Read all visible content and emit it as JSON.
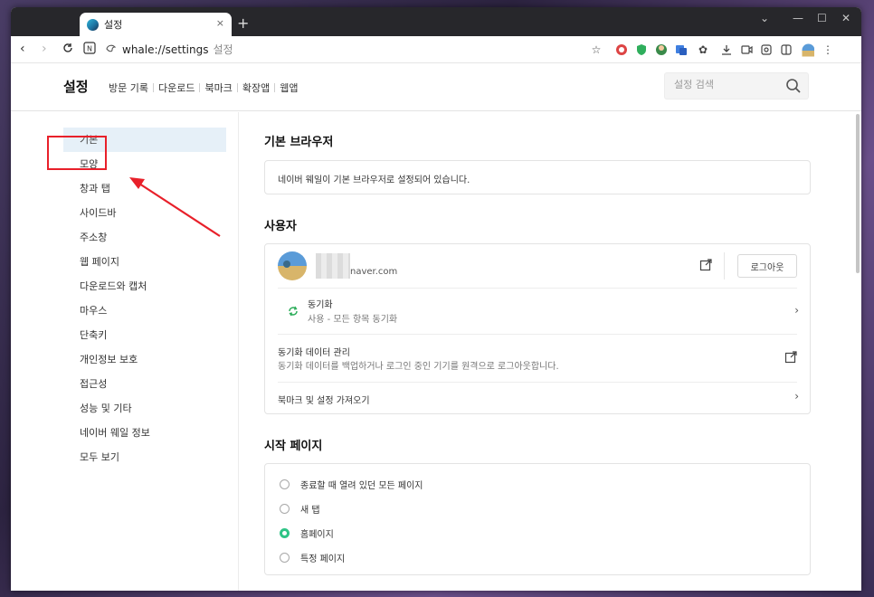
{
  "browser": {
    "tab_title": "설정",
    "new_tab_symbol": "+",
    "tab_close_symbol": "×",
    "window_controls": {
      "menu": "⌄",
      "minimize": "—",
      "maximize": "☐",
      "close": "✕"
    },
    "url": "whale://settings",
    "url_suffix": "설정"
  },
  "settings_header": {
    "title": "설정",
    "links": [
      "방문 기록",
      "다운로드",
      "북마크",
      "확장앱",
      "웹앱"
    ],
    "search_placeholder": "설정 검색"
  },
  "sidebar": {
    "items": [
      "기본",
      "모양",
      "창과 탭",
      "사이드바",
      "주소창",
      "웹 페이지",
      "다운로드와 캡처",
      "마우스",
      "단축키",
      "개인정보 보호",
      "접근성",
      "성능 및 기타",
      "네이버 웨일 정보",
      "모두 보기"
    ],
    "active_index": 0
  },
  "default_browser": {
    "title": "기본 브라우저",
    "status": "네이버 웨일이 기본 브라우저로 설정되어 있습니다."
  },
  "user": {
    "title": "사용자",
    "email_domain": "naver.com",
    "logout_label": "로그아웃",
    "sync_title": "동기화",
    "sync_desc": "사용 - 모든 항목 동기화",
    "sync_data_title": "동기화 데이터 관리",
    "sync_data_desc": "동기화 데이터를 백업하거나 로그인 중인 기기를 원격으로 로그아웃합니다.",
    "import_label": "북마크 및 설정 가져오기"
  },
  "startup": {
    "title": "시작 페이지",
    "options": [
      "종료할 때 열려 있던 모든 페이지",
      "새 탭",
      "홈페이지",
      "특정 페이지"
    ],
    "selected_index": 2
  },
  "colors": {
    "highlight": "#e8202a",
    "radio_selected": "#2fc486",
    "sidebar_active_bg": "#e6f0f8"
  }
}
